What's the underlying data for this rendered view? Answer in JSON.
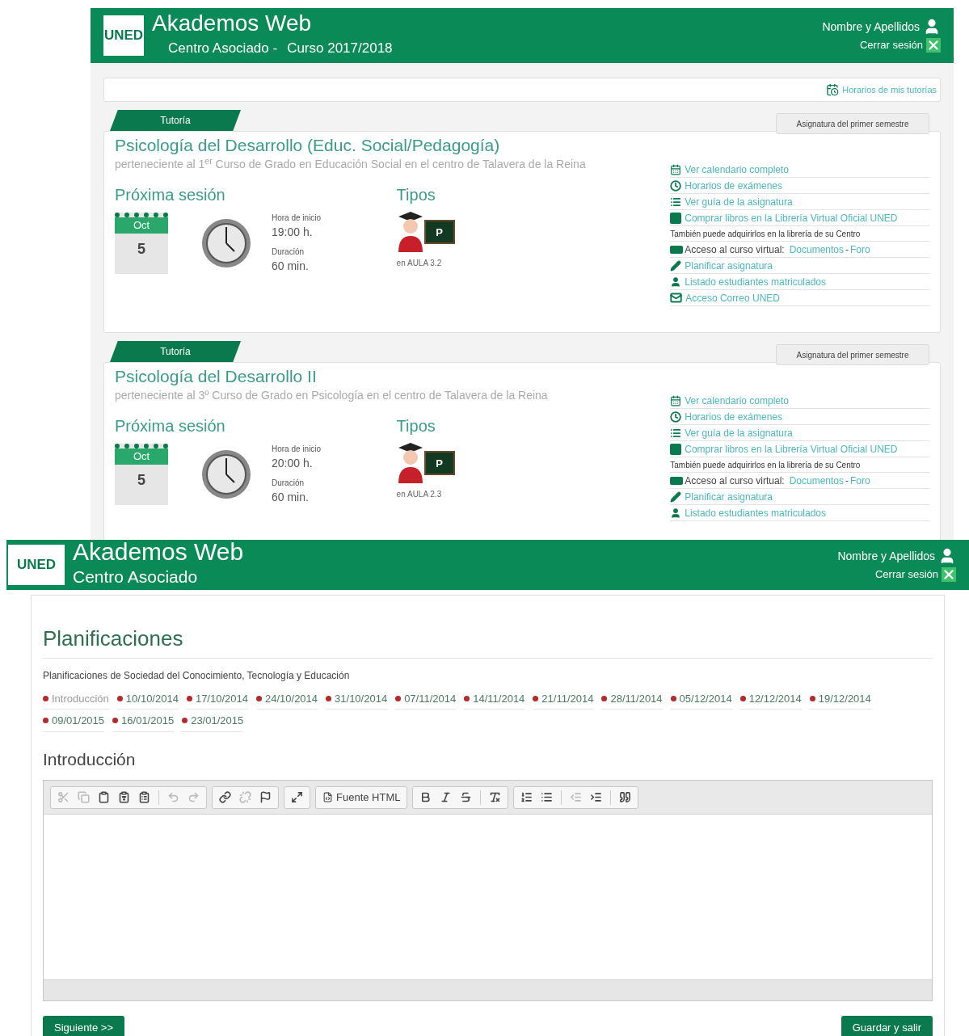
{
  "top": {
    "header": {
      "logo": "UNED",
      "title": "Akademos Web",
      "center": "Centro Asociado -",
      "course": "Curso 2017/2018",
      "user": "Nombre y Apellidos",
      "logout": "Cerrar sesión"
    },
    "schedule_link": "Horarios de mis tutorías",
    "cards": [
      {
        "tag": "Tutoría",
        "semester": "Asignatura del primer semestre",
        "title": "Psicología del Desarrollo (Educ. Social/Pedagogía)",
        "subtitle": "perteneciente al 1$^{er}$ Curso de Grado en Educación Social en el centro de Talavera de la Reina",
        "session_heading": "Próxima sesión",
        "month": "Oct",
        "day": "5",
        "start_label": "Hora de inicio",
        "start_time": "19:00 h.",
        "duration_label": "Duración",
        "duration": "60 min.",
        "types_heading": "Tipos",
        "type_letter": "P",
        "room": "en AULA 3.2",
        "links": [
          {
            "kind": "calendar",
            "text": "Ver calendario completo"
          },
          {
            "kind": "clock",
            "text": "Horarios de exámenes"
          },
          {
            "kind": "list",
            "text": "Ver guía de la asignatura"
          },
          {
            "kind": "shop",
            "text": "Comprar libros en la Librería Virtual Oficial UNED"
          },
          {
            "kind": "note",
            "text": "También puede adquirirlos en la librería de su Centro"
          },
          {
            "kind": "virtual",
            "text": "Acceso al curso virtual:",
            "link_a": "Documentos",
            "sep": "-",
            "link_b": "Foro"
          },
          {
            "kind": "pencil",
            "text": "Planificar asignatura"
          },
          {
            "kind": "user",
            "text": "Listado estudiantes matriculados"
          },
          {
            "kind": "mail",
            "text": "Acceso Correo UNED"
          }
        ]
      },
      {
        "tag": "Tutoría",
        "semester": "Asignatura del primer semestre",
        "title": "Psicología del Desarrollo II",
        "subtitle": "perteneciente al 3º Curso de Grado en Psicología en el centro de Talavera de la Reina",
        "session_heading": "Próxima sesión",
        "month": "Oct",
        "day": "5",
        "start_label": "Hora de inicio",
        "start_time": "20:00 h.",
        "duration_label": "Duración",
        "duration": "60 min.",
        "types_heading": "Tipos",
        "type_letter": "P",
        "room": "en AULA 2.3",
        "links": [
          {
            "kind": "calendar",
            "text": "Ver calendario completo"
          },
          {
            "kind": "clock",
            "text": "Horarios de exámenes"
          },
          {
            "kind": "list",
            "text": "Ver guía de la asignatura"
          },
          {
            "kind": "shop",
            "text": "Comprar libros en la Librería Virtual Oficial UNED"
          },
          {
            "kind": "note",
            "text": "También puede adquirirlos en la librería de su Centro"
          },
          {
            "kind": "virtual",
            "text": "Acceso al curso virtual:",
            "link_a": "Documentos",
            "sep": "-",
            "link_b": "Foro"
          },
          {
            "kind": "pencil",
            "text": "Planificar asignatura"
          },
          {
            "kind": "user",
            "text": "Listado estudiantes matriculados"
          }
        ]
      }
    ]
  },
  "bottom": {
    "header": {
      "logo": "UNED",
      "title": "Akademos Web",
      "subtitle": "Centro Asociado",
      "user": "Nombre y Apellidos",
      "logout": "Cerrar sesión"
    },
    "heading": "Planificaciones",
    "description": "Planificaciones de Sociedad del Conocimiento, Tecnología y Educación",
    "sessions": [
      {
        "label": "Introducción",
        "selected": true
      },
      {
        "label": "10/10/2014",
        "selected": false
      },
      {
        "label": "17/10/2014",
        "selected": false
      },
      {
        "label": "24/10/2014",
        "selected": false
      },
      {
        "label": "31/10/2014",
        "selected": false
      },
      {
        "label": "07/11/2014",
        "selected": false
      },
      {
        "label": "14/11/2014",
        "selected": false
      },
      {
        "label": "21/11/2014",
        "selected": false
      },
      {
        "label": "28/11/2014",
        "selected": false
      },
      {
        "label": "05/12/2014",
        "selected": false
      },
      {
        "label": "12/12/2014",
        "selected": false
      },
      {
        "label": "19/12/2014",
        "selected": false
      },
      {
        "label": "09/01/2015",
        "selected": false
      },
      {
        "label": "16/01/2015",
        "selected": false
      },
      {
        "label": "23/01/2015",
        "selected": false
      }
    ],
    "section_title": "Introducción",
    "toolbar": [
      [
        {
          "kind": "cut",
          "disabled": true
        },
        {
          "kind": "copy",
          "disabled": true
        },
        {
          "kind": "paste",
          "disabled": false
        },
        {
          "kind": "paste-text",
          "disabled": false
        },
        {
          "kind": "paste-word",
          "disabled": false
        },
        {
          "kind": "sep"
        },
        {
          "kind": "undo",
          "disabled": true
        },
        {
          "kind": "redo",
          "disabled": true
        }
      ],
      [
        {
          "kind": "link",
          "disabled": false
        },
        {
          "kind": "unlink",
          "disabled": true
        },
        {
          "kind": "anchor",
          "disabled": false
        }
      ],
      [
        {
          "kind": "maximize",
          "disabled": false
        }
      ],
      [
        {
          "kind": "source",
          "disabled": false,
          "label": "Fuente HTML"
        }
      ],
      [
        {
          "kind": "bold",
          "disabled": false
        },
        {
          "kind": "italic",
          "disabled": false
        },
        {
          "kind": "strike",
          "disabled": false
        },
        {
          "kind": "sep"
        },
        {
          "kind": "clear",
          "disabled": false
        }
      ],
      [
        {
          "kind": "ol",
          "disabled": false
        },
        {
          "kind": "ul",
          "disabled": false
        },
        {
          "kind": "sep"
        },
        {
          "kind": "outdent",
          "disabled": true
        },
        {
          "kind": "indent",
          "disabled": false
        },
        {
          "kind": "sep"
        },
        {
          "kind": "quote",
          "disabled": false
        }
      ]
    ],
    "next_button": "Siguiente >>",
    "save_button": "Guardar y salir"
  }
}
